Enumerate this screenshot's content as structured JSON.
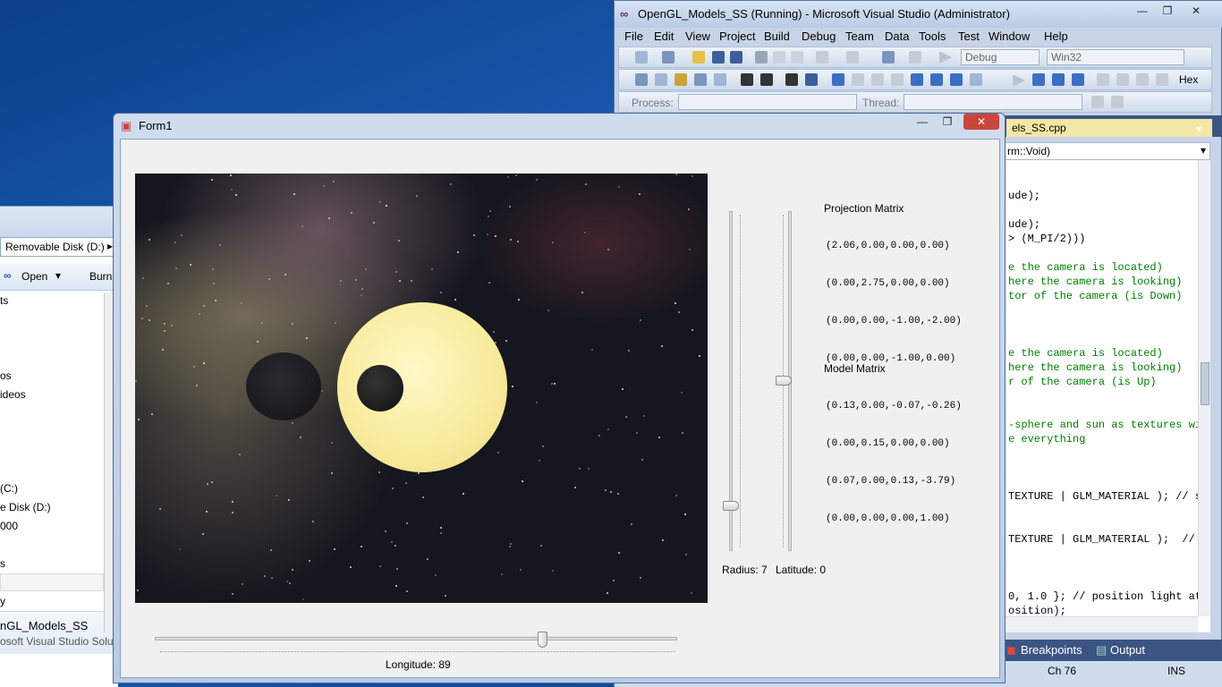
{
  "explorer": {
    "address": "Removable Disk (D:)",
    "toolbar": {
      "open_label": "Open",
      "burn_label": "Burn"
    },
    "nav_items": [
      "ts",
      "os",
      "ideos",
      "(C:)",
      "e Disk (D:)",
      "000",
      "s",
      "y"
    ],
    "selected_file": {
      "name": "nGL_Models_SS",
      "description": "osoft Visual Studio Solut"
    }
  },
  "vs": {
    "title": "OpenGL_Models_SS (Running) - Microsoft Visual Studio (Administrator)",
    "menu": [
      "File",
      "Edit",
      "View",
      "Project",
      "Build",
      "Debug",
      "Team",
      "Data",
      "Tools",
      "Test",
      "Window",
      "Help"
    ],
    "config_combo": "Debug",
    "platform_combo": "Win32",
    "hex_label": "Hex",
    "process_label": "Process:",
    "thread_label": "Thread:",
    "active_tab": "els_SS.cpp",
    "nav_combo": "rm::Void)",
    "code_lines": [
      {
        "text": "ude);",
        "comment": false
      },
      {
        "text": "",
        "comment": false
      },
      {
        "text": "ude);",
        "comment": false
      },
      {
        "text": "> (M_PI/2)))",
        "comment": false
      },
      {
        "text": "",
        "comment": false
      },
      {
        "text": "e the camera is located)",
        "comment": true
      },
      {
        "text": "here the camera is looking)",
        "comment": true
      },
      {
        "text": "tor of the camera (is Down)",
        "comment": true
      },
      {
        "text": "",
        "comment": false
      },
      {
        "text": "",
        "comment": false
      },
      {
        "text": "",
        "comment": false
      },
      {
        "text": "e the camera is located)",
        "comment": true
      },
      {
        "text": "here the camera is looking)",
        "comment": true
      },
      {
        "text": "r of the camera (is Up)",
        "comment": true
      },
      {
        "text": "",
        "comment": false
      },
      {
        "text": "",
        "comment": false
      },
      {
        "text": "-sphere and sun as textures wi",
        "comment": true
      },
      {
        "text": "e everything",
        "comment": true
      },
      {
        "text": "",
        "comment": false
      },
      {
        "text": "",
        "comment": false
      },
      {
        "text": "",
        "comment": false
      },
      {
        "text": "TEXTURE | GLM_MATERIAL ); // s",
        "comment": false
      },
      {
        "text": "",
        "comment": false
      },
      {
        "text": "",
        "comment": false
      },
      {
        "text": "TEXTURE | GLM_MATERIAL );  // s",
        "comment": false
      },
      {
        "text": "",
        "comment": false
      },
      {
        "text": "",
        "comment": false
      },
      {
        "text": "",
        "comment": false
      },
      {
        "text": "0, 1.0 }; // position light at",
        "comment": false
      },
      {
        "text": "osition);",
        "comment": false
      }
    ],
    "bottom_tabs": {
      "breakpoints": "Breakpoints",
      "output": "Output"
    },
    "status": {
      "column": "Ch 76",
      "mode": "INS"
    }
  },
  "form1": {
    "title": "Form1",
    "radius_label": "Radius: 7",
    "latitude_label": "Latitude: 0",
    "longitude_label": "Longitude: 89",
    "radius_value": 7,
    "latitude_value": 0,
    "longitude_value": 89,
    "projection": {
      "title": "Projection Matrix",
      "rows": [
        "(2.06,0.00,0.00,0.00)",
        "(0.00,2.75,0.00,0.00)",
        "(0.00,0.00,-1.00,-2.00)",
        "(0.00,0.00,-1.00,0.00)"
      ]
    },
    "model": {
      "title": "Model Matrix",
      "rows": [
        "(0.13,0.00,-0.07,-0.26)",
        "(0.00,0.15,0.00,0.00)",
        "(0.07,0.00,0.13,-3.79)",
        "(0.00,0.00,0.00,1.00)"
      ]
    }
  },
  "colors": {
    "desktop": "#1a5bb0",
    "sun": "#f8ec9e",
    "comment": "#008000"
  }
}
